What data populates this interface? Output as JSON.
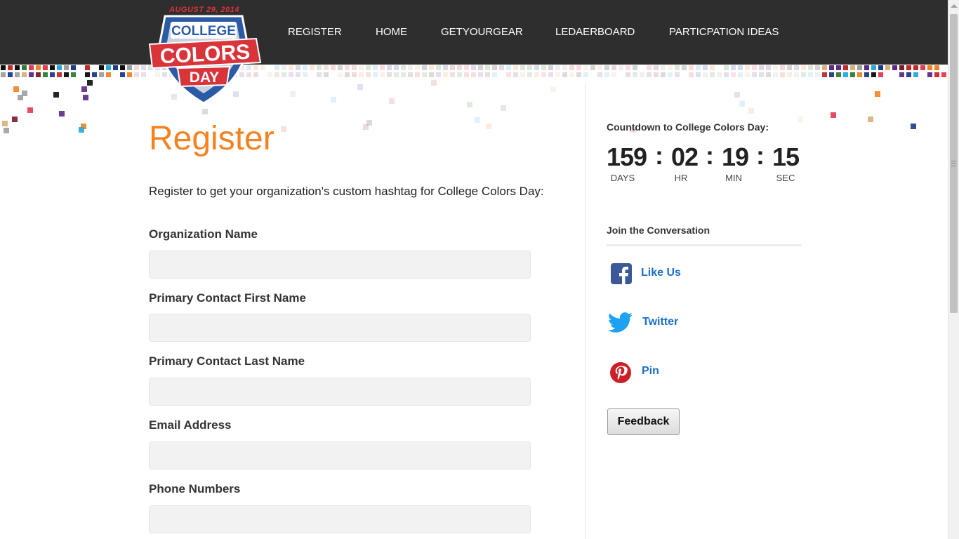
{
  "brand": {
    "logo_date": "AUGUST 29, 2014",
    "logo_line1": "COLLEGE",
    "logo_line2": "COLORS",
    "logo_line3": "DAY"
  },
  "nav": {
    "items": [
      {
        "label": "REGISTER"
      },
      {
        "label": "HOME"
      },
      {
        "label": "GETYOURGEAR"
      },
      {
        "label": "LEDAERBOARD"
      },
      {
        "label": "PARTICPATION IDEAS"
      }
    ]
  },
  "main": {
    "title": "Register",
    "intro": "Register to get your organization's custom hashtag for College Colors Day:",
    "fields": [
      {
        "label": "Organization Name",
        "value": "",
        "placeholder": ""
      },
      {
        "label": "Primary Contact First Name",
        "value": "",
        "placeholder": ""
      },
      {
        "label": "Primary Contact Last Name",
        "value": "",
        "placeholder": ""
      },
      {
        "label": "Email Address",
        "value": "",
        "placeholder": ""
      },
      {
        "label": "Phone Numbers",
        "value": "",
        "placeholder": ""
      }
    ]
  },
  "sidebar": {
    "countdown_title": "Countdown to College Colors Day:",
    "countdown": {
      "days": "159",
      "hours": "02",
      "minutes": "19",
      "seconds": "15",
      "separator": ":",
      "days_label": "DAYS",
      "hours_label": "HR",
      "minutes_label": "MIN",
      "seconds_label": "SEC"
    },
    "join_title": "Join the Conversation",
    "social": [
      {
        "label": "Like Us",
        "icon": "facebook-icon",
        "color": "#3b5998"
      },
      {
        "label": "Twitter",
        "icon": "twitter-icon",
        "color": "#1da1f2"
      },
      {
        "label": "Pin",
        "icon": "pinterest-icon",
        "color": "#cb2027"
      }
    ],
    "feedback_label": "Feedback"
  },
  "colors": {
    "accent_orange": "#f58220",
    "header_bg": "#2e2e2e",
    "link_blue": "#1a6fc9"
  }
}
